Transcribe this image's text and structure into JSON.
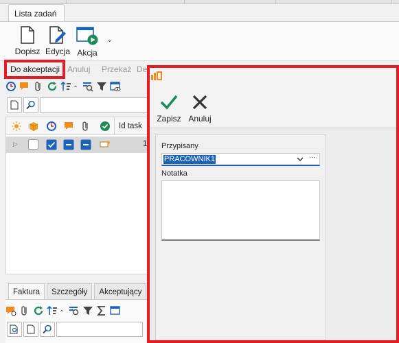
{
  "document_tab": {
    "label": "Lista zadań"
  },
  "ribbon": {
    "add_label": "Dopisz",
    "edit_label": "Edycja",
    "action_label": "Akcja",
    "more_glyph": "⌄"
  },
  "command_bar": {
    "to_accept_label": "Do akceptacji",
    "cancel_label": "Anuluj",
    "transfer_label": "Przekaż",
    "truncated_label": "De"
  },
  "grid": {
    "columns": [
      "Id task"
    ],
    "rows": [
      {
        "id_cut": "1"
      }
    ]
  },
  "bottom_tabs": [
    "Faktura",
    "Szczegóły",
    "Akceptujący"
  ],
  "dialog": {
    "save_label": "Zapisz",
    "cancel_label": "Anuluj",
    "assigned_label": "Przypisany",
    "assigned_value": "PRACOWNIK1",
    "ellipsis": "···",
    "note_label": "Notatka"
  },
  "colors": {
    "highlight": "#e31b23",
    "accent": "#1b63b8",
    "save_check": "#1e8a5a"
  }
}
